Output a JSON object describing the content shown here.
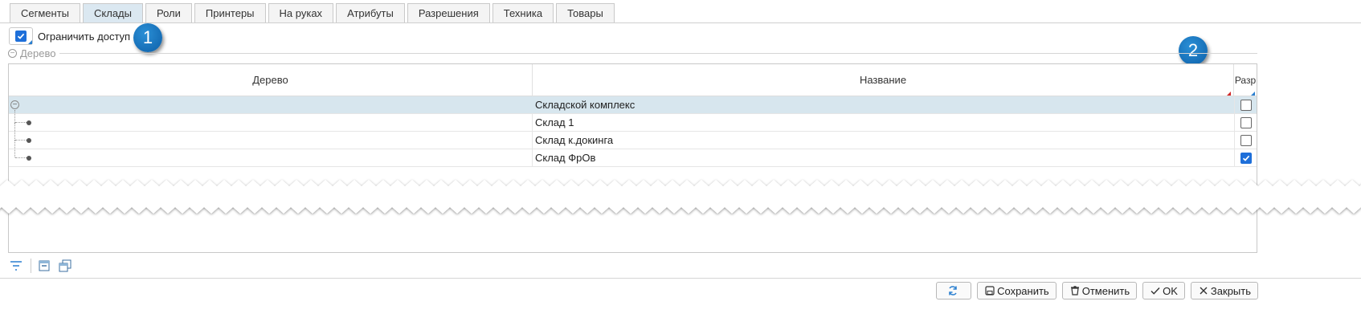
{
  "tabs": [
    {
      "label": "Сегменты",
      "active": false
    },
    {
      "label": "Склады",
      "active": true
    },
    {
      "label": "Роли",
      "active": false
    },
    {
      "label": "Принтеры",
      "active": false
    },
    {
      "label": "На руках",
      "active": false
    },
    {
      "label": "Атрибуты",
      "active": false
    },
    {
      "label": "Разрешения",
      "active": false
    },
    {
      "label": "Техника",
      "active": false
    },
    {
      "label": "Товары",
      "active": false
    }
  ],
  "restrict_access": {
    "label": "Ограничить доступ",
    "checked": true
  },
  "callouts": [
    "1",
    "2"
  ],
  "group": {
    "title": "Дерево"
  },
  "grid": {
    "columns": [
      "Дерево",
      "Название",
      "Разр"
    ],
    "rows": [
      {
        "name": "Складской комплекс",
        "checked": false,
        "selected": true,
        "root": true
      },
      {
        "name": "Склад 1",
        "checked": false,
        "selected": false,
        "root": false
      },
      {
        "name": "Склад к.докинга",
        "checked": false,
        "selected": false,
        "root": false
      },
      {
        "name": "Склад ФрОв",
        "checked": true,
        "selected": false,
        "root": false
      }
    ]
  },
  "toolbar": {
    "icons": [
      "filter-icon",
      "collapse-all-icon",
      "expand-all-icon"
    ]
  },
  "buttons": {
    "refresh": "",
    "save": "Сохранить",
    "cancel": "Отменить",
    "ok": "OK",
    "close": "Закрыть"
  },
  "colors": {
    "accent": "#1e6fd9",
    "selected_row": "#d7e6ee",
    "active_tab": "#dbe8f1",
    "callout": "#1a74bf"
  }
}
